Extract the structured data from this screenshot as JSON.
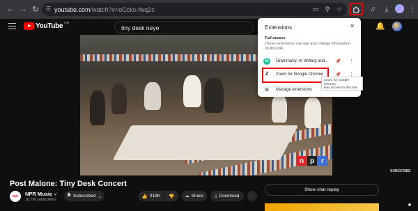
{
  "browser": {
    "url_host": "youtube.com",
    "url_path": "/watch?v=oCcks-fwq2c"
  },
  "youtube": {
    "logo_text": "YouTube",
    "region": "PH",
    "search_query": "tiny desk neyo"
  },
  "video": {
    "watermark": "SUBSCRIBE",
    "brand_letters": [
      "n",
      "p",
      "r"
    ],
    "brand_colors": [
      "#e3252b",
      "#222222",
      "#3b6fd9"
    ]
  },
  "info": {
    "title": "Post Malone: Tiny Desk Concert",
    "channel_avatar_text": "npr",
    "channel_name": "NPR Music",
    "subscribers": "10.7M subscribers",
    "subscribed_label": "Subscribed",
    "likes": "419K",
    "share_label": "Share",
    "download_label": "Download",
    "more_label": "···",
    "chat_replay_label": "Show chat replay"
  },
  "extensions_popup": {
    "title": "Extensions",
    "full_access_heading": "Full access",
    "full_access_desc": "These extensions can see and change information on this site.",
    "items": [
      {
        "name": "Grammarly: AI Writing and...",
        "icon": "G",
        "color": "#15c39a"
      },
      {
        "name": "Zoom for Google Chrome",
        "icon": "Z",
        "color": "#202124"
      }
    ],
    "manage_label": "Manage extensions",
    "tooltip_lines": [
      "Zoom for Google Chrome",
      "Has access to this site"
    ]
  },
  "colors": {
    "highlight": "#ee0000",
    "yt_red": "#ff0000"
  }
}
